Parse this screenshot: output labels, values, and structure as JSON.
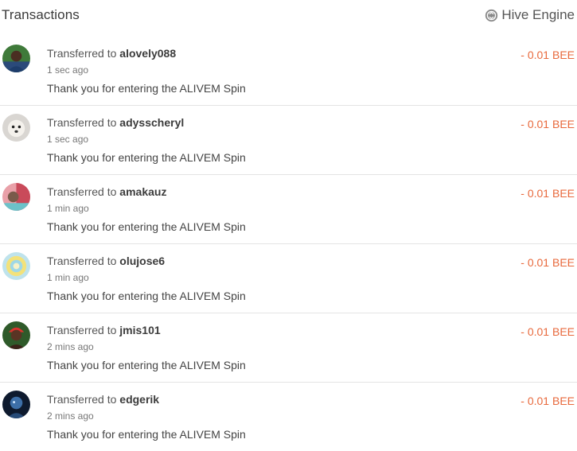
{
  "header": {
    "title": "Transactions",
    "engine_label": "Hive Engine",
    "engine_icon": "hive-engine-icon"
  },
  "colors": {
    "amount_negative": "#e8693c",
    "divider": "#e4e4e4"
  },
  "transactions": [
    {
      "prefix": "Transferred to",
      "user": "alovely088",
      "time": "1 sec ago",
      "memo": "Thank you for entering the ALIVEM Spin",
      "amount": "- 0.01 BEE"
    },
    {
      "prefix": "Transferred to",
      "user": "adysscheryl",
      "time": "1 sec ago",
      "memo": "Thank you for entering the ALIVEM Spin",
      "amount": "- 0.01 BEE"
    },
    {
      "prefix": "Transferred to",
      "user": "amakauz",
      "time": "1 min ago",
      "memo": "Thank you for entering the ALIVEM Spin",
      "amount": "- 0.01 BEE"
    },
    {
      "prefix": "Transferred to",
      "user": "olujose6",
      "time": "1 min ago",
      "memo": "Thank you for entering the ALIVEM Spin",
      "amount": "- 0.01 BEE"
    },
    {
      "prefix": "Transferred to",
      "user": "jmis101",
      "time": "2 mins ago",
      "memo": "Thank you for entering the ALIVEM Spin",
      "amount": "- 0.01 BEE"
    },
    {
      "prefix": "Transferred to",
      "user": "edgerik",
      "time": "2 mins ago",
      "memo": "Thank you for entering the ALIVEM Spin",
      "amount": "- 0.01 BEE"
    }
  ]
}
